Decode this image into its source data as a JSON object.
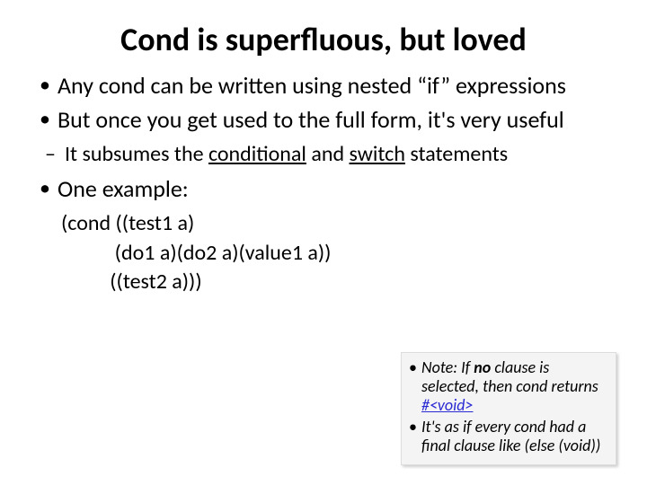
{
  "title": "Cond is superfluous, but loved",
  "bullets": {
    "b1a": "Any cond can be written using nested ",
    "b1b": "“if”",
    "b1c": " expressions",
    "b2": "But once you get used to the full form, it's very useful",
    "sub_a": "It subsumes the ",
    "sub_cond": "conditional",
    "sub_and": " and ",
    "sub_switch": "switch",
    "sub_end": " statements",
    "b3": "One example:"
  },
  "code": {
    "l1": "(cond ((test1 a)",
    "l2": "           (do1 a)(do2 a)(value1 a))",
    "l3": "          ((test2 a)))"
  },
  "note": {
    "n1a": "Note: If ",
    "n1_no": "no",
    "n1b": " clause is selected, then cond returns ",
    "n1_void": "#<void>",
    "n2": "It's as if every cond had a final clause like (else (void))"
  }
}
